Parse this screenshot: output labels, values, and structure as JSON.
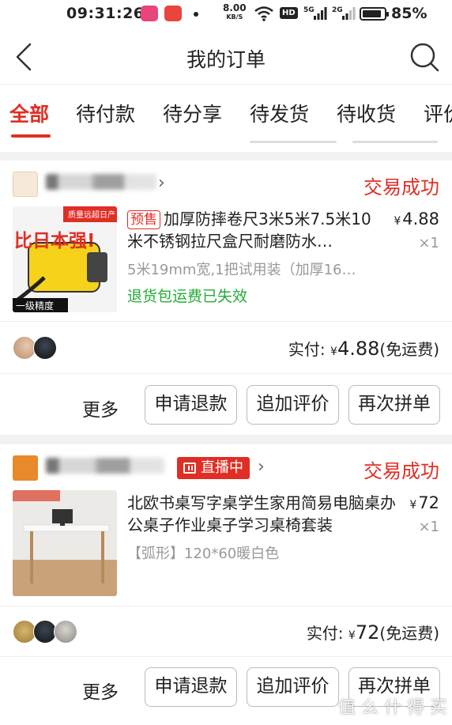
{
  "status_bar": {
    "time": "09:31:26",
    "net_speed": "8.00",
    "net_unit": "KB/S",
    "hd": "HD",
    "sig1": "5G",
    "sig2": "2G",
    "battery": "85%"
  },
  "header": {
    "title": "我的订单"
  },
  "tabs": [
    "全部",
    "待付款",
    "待分享",
    "待发货",
    "待收货",
    "评价"
  ],
  "orders": [
    {
      "status": "交易成功",
      "thumb_badge": "质量远超日产",
      "thumb_text": "比日本强!",
      "thumb_footer": "一级精度",
      "presale": "预售",
      "title": "加厚防摔卷尺3米5米7.5米10米不锈钢拉尺盒尺耐磨防水…",
      "price_symbol": "¥",
      "price": "4.88",
      "qty": "×1",
      "spec": "5米19mm宽,1把试用装（加厚16…",
      "notice": "退货包运费已失效",
      "paid_label": "实付:",
      "paid_symbol": "¥",
      "paid_amount": "4.88",
      "paid_note": "(免运费)",
      "more": "更多",
      "buttons": [
        "申请退款",
        "追加评价",
        "再次拼单"
      ]
    },
    {
      "status": "交易成功",
      "live": "直播中",
      "title": "北欧书桌写字桌学生家用简易电脑桌办公桌子作业桌子学习桌椅套装",
      "price_symbol": "¥",
      "price": "72",
      "qty": "×1",
      "spec": "【弧形】120*60暖白色",
      "paid_label": "实付:",
      "paid_symbol": "¥",
      "paid_amount": "72",
      "paid_note": "(免运费)",
      "more": "更多",
      "buttons": [
        "申请退款",
        "追加评价",
        "再次拼单"
      ]
    }
  ],
  "watermark": "值 么 什 得 买",
  "colors": {
    "accent": "#e02e24",
    "success": "#23ac38"
  }
}
